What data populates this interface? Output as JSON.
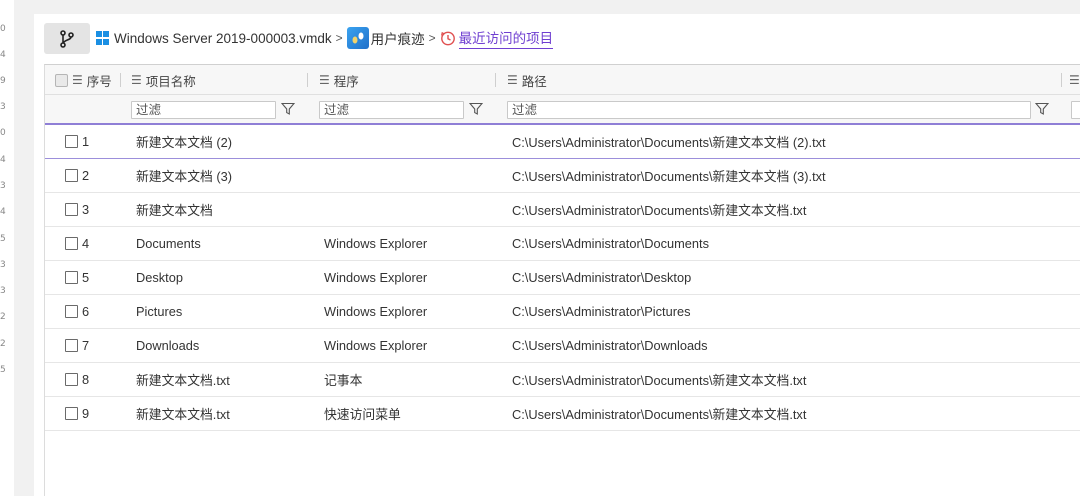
{
  "gutter_numbers": [
    "0",
    "4",
    "9",
    "3",
    "0",
    "4",
    "3",
    "4",
    "5",
    "3",
    "3",
    "2",
    "2",
    "5"
  ],
  "breadcrumb": {
    "source": "Windows Server 2019-000003.vmdk",
    "trace": "用户痕迹",
    "current": "最近访问的项目"
  },
  "columns": {
    "index": "序号",
    "name": "项目名称",
    "program": "程序",
    "path": "路径"
  },
  "filter_placeholder": "过滤",
  "rows": [
    {
      "index": "1",
      "name": "新建文本文档 (2)",
      "program": "",
      "path": "C:\\Users\\Administrator\\Documents\\新建文本文档 (2).txt"
    },
    {
      "index": "2",
      "name": "新建文本文档 (3)",
      "program": "",
      "path": "C:\\Users\\Administrator\\Documents\\新建文本文档 (3).txt"
    },
    {
      "index": "3",
      "name": "新建文本文档",
      "program": "",
      "path": "C:\\Users\\Administrator\\Documents\\新建文本文档.txt"
    },
    {
      "index": "4",
      "name": "Documents",
      "program": "Windows Explorer",
      "path": "C:\\Users\\Administrator\\Documents"
    },
    {
      "index": "5",
      "name": "Desktop",
      "program": "Windows Explorer",
      "path": "C:\\Users\\Administrator\\Desktop"
    },
    {
      "index": "6",
      "name": "Pictures",
      "program": "Windows Explorer",
      "path": "C:\\Users\\Administrator\\Pictures"
    },
    {
      "index": "7",
      "name": "Downloads",
      "program": "Windows Explorer",
      "path": "C:\\Users\\Administrator\\Downloads"
    },
    {
      "index": "8",
      "name": "新建文本文档.txt",
      "program": "记事本",
      "path": "C:\\Users\\Administrator\\Documents\\新建文本文档.txt"
    },
    {
      "index": "9",
      "name": "新建文本文档.txt",
      "program": "快速访问菜单",
      "path": "C:\\Users\\Administrator\\Documents\\新建文本文档.txt"
    }
  ],
  "colors": {
    "accent": "#6f3fd1",
    "windows_blue": "#1a8fe3"
  },
  "icons": {
    "branch": "branch-icon",
    "windows": "windows-logo-icon",
    "trace": "user-trace-icon",
    "clock": "history-clock-icon",
    "column_menu": "column-menu-icon",
    "filter": "funnel-icon"
  }
}
